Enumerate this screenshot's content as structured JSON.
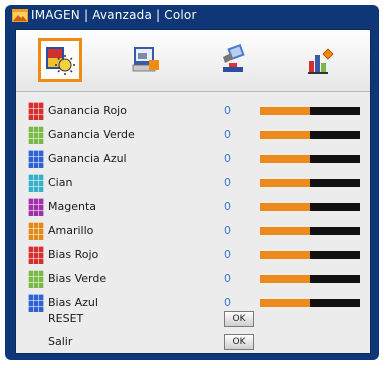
{
  "window": {
    "title": "IMAGEN | Avanzada | Color"
  },
  "tabs": [
    {
      "icon": "image-settings-icon",
      "active": true
    },
    {
      "icon": "display-settings-icon",
      "active": false
    },
    {
      "icon": "setup-icon",
      "active": false
    },
    {
      "icon": "options-icon",
      "active": false
    }
  ],
  "rows": [
    {
      "label": "Ganancia Rojo",
      "value": "0",
      "level": 0.5,
      "color": "#d43030"
    },
    {
      "label": "Ganancia Verde",
      "value": "0",
      "level": 0.5,
      "color": "#7ab84a"
    },
    {
      "label": "Ganancia Azul",
      "value": "0",
      "level": 0.5,
      "color": "#2f62d0"
    },
    {
      "label": "Cian",
      "value": "0",
      "level": 0.5,
      "color": "#3ab0c8"
    },
    {
      "label": "Magenta",
      "value": "0",
      "level": 0.5,
      "color": "#a030a8"
    },
    {
      "label": "Amarillo",
      "value": "0",
      "level": 0.5,
      "color": "#e08a1a"
    },
    {
      "label": "Bias Rojo",
      "value": "0",
      "level": 0.5,
      "color": "#d43030"
    },
    {
      "label": "Bias Verde",
      "value": "0",
      "level": 0.5,
      "color": "#7ab84a"
    },
    {
      "label": "Bias Azul",
      "value": "0",
      "level": 0.5,
      "color": "#2f62d0"
    }
  ],
  "reset": {
    "label": "RESET",
    "button": "OK"
  },
  "exit": {
    "label": "Salir",
    "button": "OK"
  },
  "colors": {
    "frame": "#0f3677",
    "accent": "#f08a10",
    "value_text": "#3a78d8",
    "slider_track": "#111111",
    "slider_fill": "#ee8a1c"
  }
}
